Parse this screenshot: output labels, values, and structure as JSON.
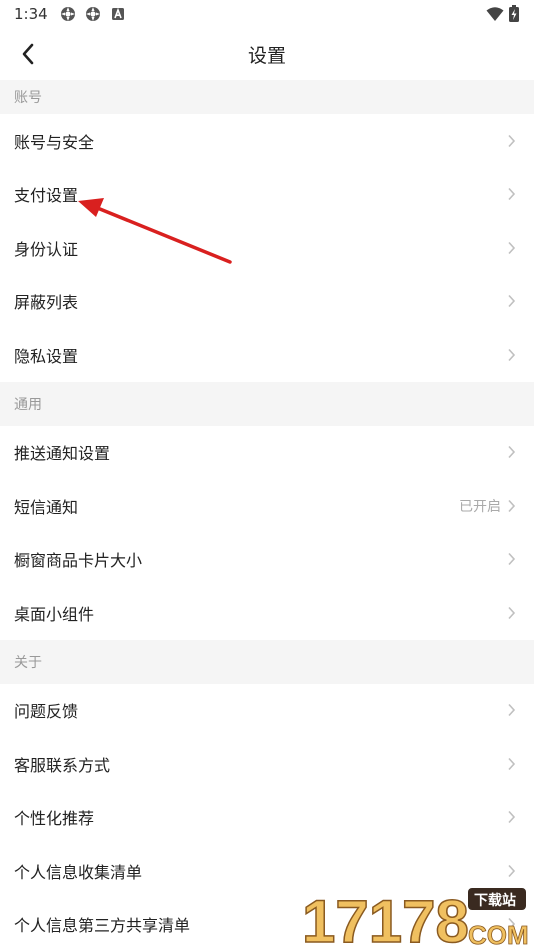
{
  "status_bar": {
    "time": "1:34",
    "icons": [
      "settings-icon",
      "settings-icon",
      "a-icon",
      "wifi-icon",
      "battery-icon"
    ]
  },
  "nav": {
    "title": "设置",
    "back_icon": "chevron-left-icon"
  },
  "sections": [
    {
      "header": "账号",
      "items": [
        {
          "label": "账号与安全",
          "value": ""
        },
        {
          "label": "支付设置",
          "value": ""
        },
        {
          "label": "身份认证",
          "value": ""
        },
        {
          "label": "屏蔽列表",
          "value": ""
        },
        {
          "label": "隐私设置",
          "value": ""
        }
      ]
    },
    {
      "header": "通用",
      "items": [
        {
          "label": "推送通知设置",
          "value": ""
        },
        {
          "label": "短信通知",
          "value": "已开启"
        },
        {
          "label": "橱窗商品卡片大小",
          "value": ""
        },
        {
          "label": "桌面小组件",
          "value": ""
        }
      ]
    },
    {
      "header": "关于",
      "items": [
        {
          "label": "问题反馈",
          "value": ""
        },
        {
          "label": "客服联系方式",
          "value": ""
        },
        {
          "label": "个性化推荐",
          "value": ""
        },
        {
          "label": "个人信息收集清单",
          "value": ""
        },
        {
          "label": "个人信息第三方共享清单",
          "value": ""
        }
      ]
    }
  ],
  "annotation": {
    "arrow_color": "#d9201f"
  },
  "watermark": {
    "number": "17178",
    "tag": "下载站",
    "suffix": "COM"
  },
  "colors": {
    "section_bg": "#f5f5f5",
    "secondary_text": "#999999",
    "chevron": "#c0c0c0"
  }
}
